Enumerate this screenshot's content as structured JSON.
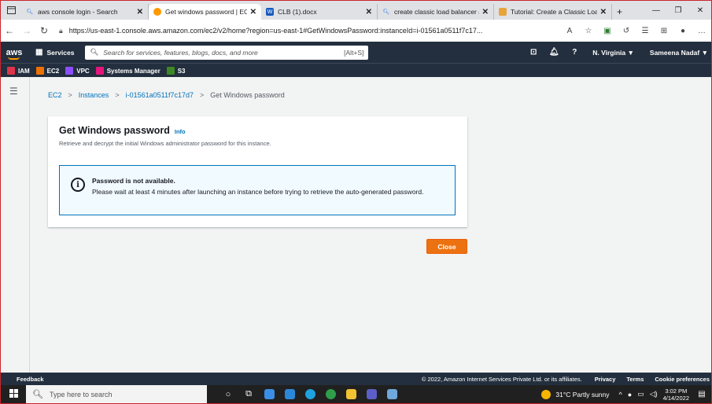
{
  "browser": {
    "tabs": [
      {
        "title": "aws console login - Search",
        "favicon": "search-icon",
        "color": "#1a73e8"
      },
      {
        "title": "Get windows password | EC2",
        "favicon": "aws-icon",
        "color": "#ff9900",
        "active": true
      },
      {
        "title": "CLB (1).docx",
        "favicon": "word-icon",
        "color": "#185abd"
      },
      {
        "title": "create classic load balancer a",
        "favicon": "search-icon",
        "color": "#1a73e8"
      },
      {
        "title": "Tutorial: Create a Classic Loa",
        "favicon": "doc-icon",
        "color": "#e8a33a"
      }
    ],
    "new_tab": "+",
    "url": "https://us-east-1.console.aws.amazon.com/ec2/v2/home?region=us-east-1#GetWindowsPassword:instanceId=i-01561a0511f7c17..."
  },
  "aws_header": {
    "logo": "aws",
    "services": "Services",
    "search_placeholder": "Search for services, features, blogs, docs, and more",
    "search_shortcut": "[Alt+S]",
    "region": "N. Virginia ▼",
    "user": "Sameena Nadaf ▼"
  },
  "favorites": [
    {
      "label": "IAM",
      "color": "#dd344c"
    },
    {
      "label": "EC2",
      "color": "#ed7100"
    },
    {
      "label": "VPC",
      "color": "#8c4fff"
    },
    {
      "label": "Systems Manager",
      "color": "#e7157b"
    },
    {
      "label": "S3",
      "color": "#3f8624"
    }
  ],
  "breadcrumb": {
    "items": [
      "EC2",
      "Instances",
      "i-01561a0511f7c17d7"
    ],
    "current": "Get Windows password",
    "separator": ">"
  },
  "panel": {
    "title": "Get Windows password",
    "info": "Info",
    "subtitle": "Retrieve and decrypt the initial Windows administrator password for this instance.",
    "alert_title": "Password is not available.",
    "alert_body": "Please wait at least 4 minutes after launching an instance before trying to retrieve the auto-generated password.",
    "close_label": "Close"
  },
  "footer": {
    "feedback": "Feedback",
    "copyright": "© 2022, Amazon Internet Services Private Ltd. or its affiliates.",
    "privacy": "Privacy",
    "terms": "Terms",
    "cookies": "Cookie preferences"
  },
  "taskbar": {
    "search_placeholder": "Type here to search",
    "weather": "31°C  Partly sunny",
    "time": "3:02 PM",
    "date": "4/14/2022"
  }
}
